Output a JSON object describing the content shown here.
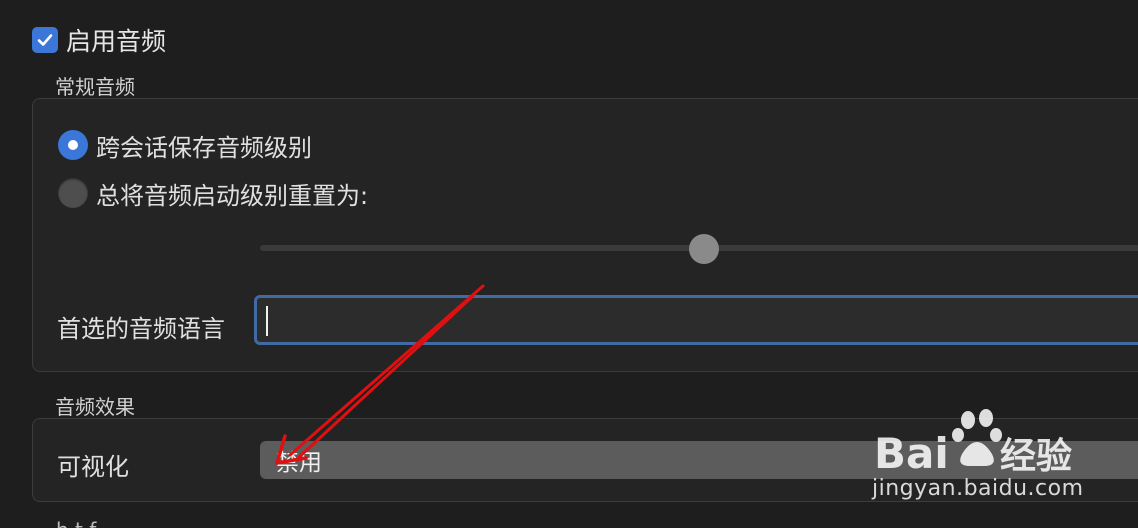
{
  "audio": {
    "enable_label": "启用音频",
    "enable_checked": true
  },
  "general": {
    "title": "常规音频",
    "radio_keep_label": "跨会话保存音频级别",
    "radio_reset_label": "总将音频启动级别重置为:",
    "selected": "keep",
    "preferred_language_label": "首选的音频语言",
    "preferred_language_value": ""
  },
  "effects": {
    "title": "音频效果",
    "visualize_label": "可视化",
    "visualize_value": "禁用"
  },
  "watermark": {
    "brand": "Bai du 经验",
    "url": "jingyan.baidu.com"
  },
  "colors": {
    "accent": "#3b76d9",
    "annotation_arrow": "#e01010"
  },
  "bottom_text": "h   t f"
}
